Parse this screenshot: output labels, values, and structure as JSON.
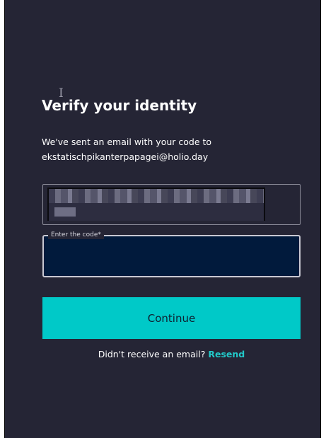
{
  "header": {
    "title": "Verify your identity"
  },
  "message": {
    "line1": "We've sent an email with your code to",
    "email": "ekstatischpikanterpapagei@holio.day"
  },
  "code_field": {
    "label": "Enter the code*",
    "value": ""
  },
  "actions": {
    "continue_label": "Continue",
    "resend_prompt": "Didn't receive an email?",
    "resend_label": "Resend"
  },
  "colors": {
    "panel_background": "#252535",
    "input_background": "#011a3c",
    "accent": "#00c9c8",
    "link": "#22c8c8"
  },
  "icons": {
    "cursor": "text-cursor-icon"
  }
}
